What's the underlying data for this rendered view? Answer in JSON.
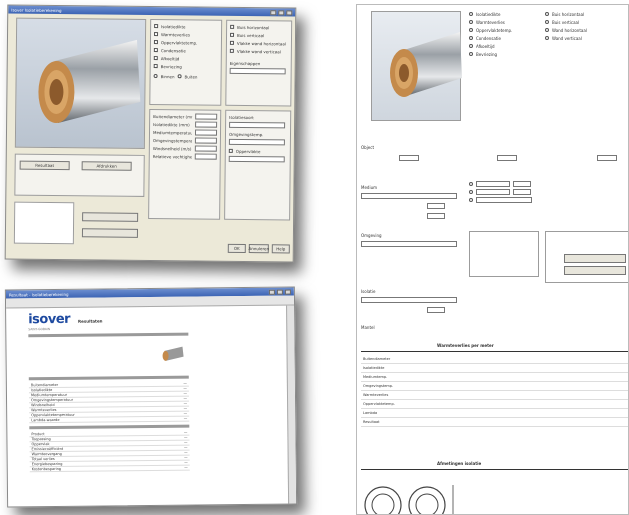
{
  "window1": {
    "title": "Isover Isolatieberekening",
    "section_labels": [
      "Oppervlakte",
      "Isolatiesoort",
      "Omgevingstemp.",
      "Eigenschappen"
    ],
    "options_col1": [
      "Isolatiedikte",
      "Warmteverlies",
      "Oppervlaktetemp.",
      "Condensatie",
      "Afkoeltijd",
      "Bevriezing"
    ],
    "options_col2": [
      "Buis horizontaal",
      "Buis verticaal",
      "Vlakke wand horizontaal",
      "Vlakke wand verticaal"
    ],
    "radio_options": [
      "Binnen",
      "Buiten"
    ],
    "buttons": [
      "Resultaat",
      "Afdrukken",
      "OK",
      "Annuleren",
      "Help"
    ],
    "field_labels": [
      "Buitendiameter (mm)",
      "Isolatiedikte (mm)",
      "Mediumtemperatuur (°C)",
      "Omgevingstemperatuur (°C)",
      "Windsnelheid (m/s)",
      "Relatieve vochtigheid (%)"
    ]
  },
  "window2": {
    "title": "Resultaat - Isolatieberekening",
    "logo": "isover",
    "logo_sub": "SAINT-GOBAIN",
    "heading": "Resultaten",
    "rows_a": [
      "Buitendiameter",
      "Isolatiedikte",
      "Mediumtemperatuur",
      "Omgevingstemperatuur",
      "Windsnelheid",
      "Warmteverlies",
      "Oppervlaktetemperatuur",
      "Lambda-waarde"
    ],
    "rows_b": [
      "Product",
      "Toepassing",
      "Oppervlak",
      "Emissiecoëfficiënt",
      "Warmteovergang",
      "Totaal verlies",
      "Energiebesparing",
      "Kostenbesparing"
    ]
  },
  "window3": {
    "options": [
      "Isolatiedikte",
      "Warmteverlies",
      "Oppervlaktetemp.",
      "Condensatie",
      "Afkoeltijd",
      "Bevriezing",
      "Buis horizontaal",
      "Buis verticaal",
      "Wand horizontaal",
      "Wand verticaal"
    ],
    "labels_left": [
      "Object",
      "Medium",
      "Omgeving",
      "Isolatie",
      "Mantel"
    ],
    "heading_results": "Warmteverlies per meter",
    "heading_bottom": "Afmetingen isolatie",
    "result_rows": [
      "Buitendiameter",
      "Isolatiedikte",
      "Mediumtemp.",
      "Omgevingstemp.",
      "Warmteverlies",
      "Oppervlaktetemp.",
      "Lambda",
      "Resultaat"
    ]
  },
  "colors": {
    "titlebar": "#3c64b4",
    "window_bg": "#ece9d8",
    "brand": "#1e4aa0"
  }
}
